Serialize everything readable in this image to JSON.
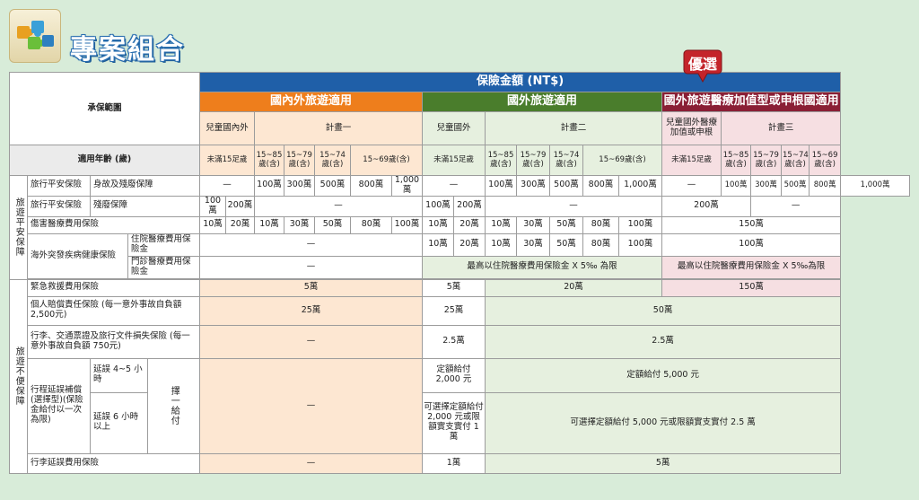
{
  "title": "專案組合",
  "badge": "優選",
  "header": {
    "coverage_scope": "承保範圍",
    "insured_amount": "保險金額 (NT$)",
    "plan_groups": [
      "國內外旅遊適用",
      "國外旅遊適用",
      "國外旅遊醫療加值型或申根國適用"
    ],
    "sub": {
      "child_domestic": "兒童國內外",
      "plan1": "計畫一",
      "child_abroad": "兒童國外",
      "plan2": "計畫二",
      "child_abroad_medical": "兒童國外醫療加值或申根",
      "plan3": "計畫三"
    },
    "age_label": "適用年齡 (歲)",
    "ages": {
      "under15": "未滿15足歲",
      "a85": "15~85歲(含)",
      "a79": "15~79歲(含)",
      "a74": "15~74歲(含)",
      "a69": "15~69歲(含)"
    }
  },
  "sections": {
    "travel_accident": "旅遊平安保障",
    "travel_inconvenience": "旅遊不便保障"
  },
  "rows": {
    "r1": {
      "label_a": "旅行平安保險",
      "label_b": "身故及殘廢保障",
      "dash": "—",
      "v1": [
        "100萬",
        "300萬",
        "500萬",
        "800萬",
        "1,000萬"
      ]
    },
    "r2": {
      "label_a": "旅行平安保險",
      "label_b": "殘廢保障",
      "c1": "100萬",
      "c2": "200萬",
      "dash": "—",
      "p3": "200萬"
    },
    "r3": {
      "label": "傷害醫療費用保險",
      "a": "10萬",
      "b": "20萬",
      "v": [
        "10萬",
        "30萬",
        "50萬",
        "80萬",
        "100萬"
      ],
      "p3": "150萬"
    },
    "r4": {
      "label_a": "海外突發疾病健康保險",
      "label_b": "住院醫療費用保險金",
      "dash": "—",
      "p3": "100萬"
    },
    "r5": {
      "label_b": "門診醫療費用保險金",
      "dash": "—",
      "p2": "最高以住院醫療費用保險金 X 5‰ 為限",
      "p3": "最高以住院醫療費用保險金 X 5‰為限"
    },
    "r6": {
      "label": "緊急救援費用保險",
      "p1": "5萬",
      "c2": "5萬",
      "p2": "20萬",
      "p3": "150萬"
    },
    "r7": {
      "label": "個人賠償責任保險 (每一意外事故自負額 2,500元)",
      "p1": "25萬",
      "c2": "25萬",
      "p3": "50萬"
    },
    "r8": {
      "label": "行李、交通票證及旅行文件損失保險 (每一意外事故自負額 750元)",
      "dash": "—",
      "c2": "2.5萬",
      "p3": "2.5萬"
    },
    "r9": {
      "label": "行程延誤補償 (選擇型)(保險金給付以一次為限)",
      "delay_a": "延誤 4~5 小時",
      "delay_b": "延誤 6 小時以上",
      "choose": "擇一給付",
      "dash": "—",
      "c2a": "定額給付 2,000 元",
      "p3a": "定額給付 5,000 元",
      "c2b": "可選擇定額給付 2,000 元或限額實支實付 1 萬",
      "p3b": "可選擇定額給付 5,000 元或限額實支實付 2.5 萬"
    },
    "r10": {
      "label": "行李延誤費用保險",
      "dash": "—",
      "c2": "1萬",
      "p3": "5萬"
    }
  }
}
